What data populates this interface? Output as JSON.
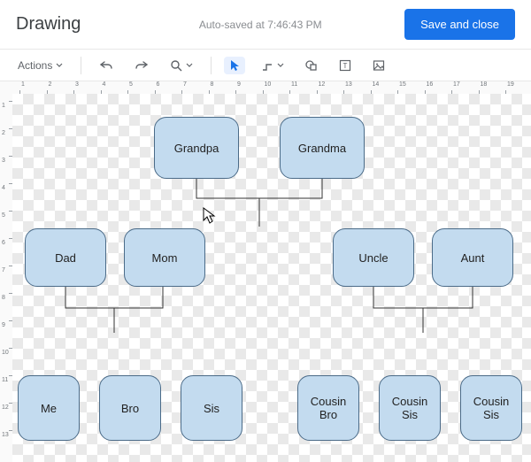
{
  "header": {
    "title": "Drawing",
    "status": "Auto-saved at 7:46:43 PM",
    "save_label": "Save and close"
  },
  "toolbar": {
    "actions_label": "Actions"
  },
  "ruler_h": [
    "1",
    "2",
    "3",
    "4",
    "5",
    "6",
    "7",
    "8",
    "9",
    "10",
    "11",
    "12",
    "13",
    "14",
    "15",
    "16",
    "17",
    "18",
    "19"
  ],
  "ruler_v": [
    "1",
    "2",
    "3",
    "4",
    "5",
    "6",
    "7",
    "8",
    "9",
    "10",
    "11",
    "12",
    "13"
  ],
  "nodes": {
    "grandpa": "Grandpa",
    "grandma": "Grandma",
    "dad": "Dad",
    "mom": "Mom",
    "uncle": "Uncle",
    "aunt": "Aunt",
    "me": "Me",
    "bro": "Bro",
    "sis": "Sis",
    "cousin_bro": "Cousin Bro",
    "cousin_sis1": "Cousin Sis",
    "cousin_sis2": "Cousin Sis"
  },
  "colors": {
    "node_fill": "#c3dbef",
    "node_border": "#4b6b88",
    "primary_button": "#1a73e8"
  }
}
